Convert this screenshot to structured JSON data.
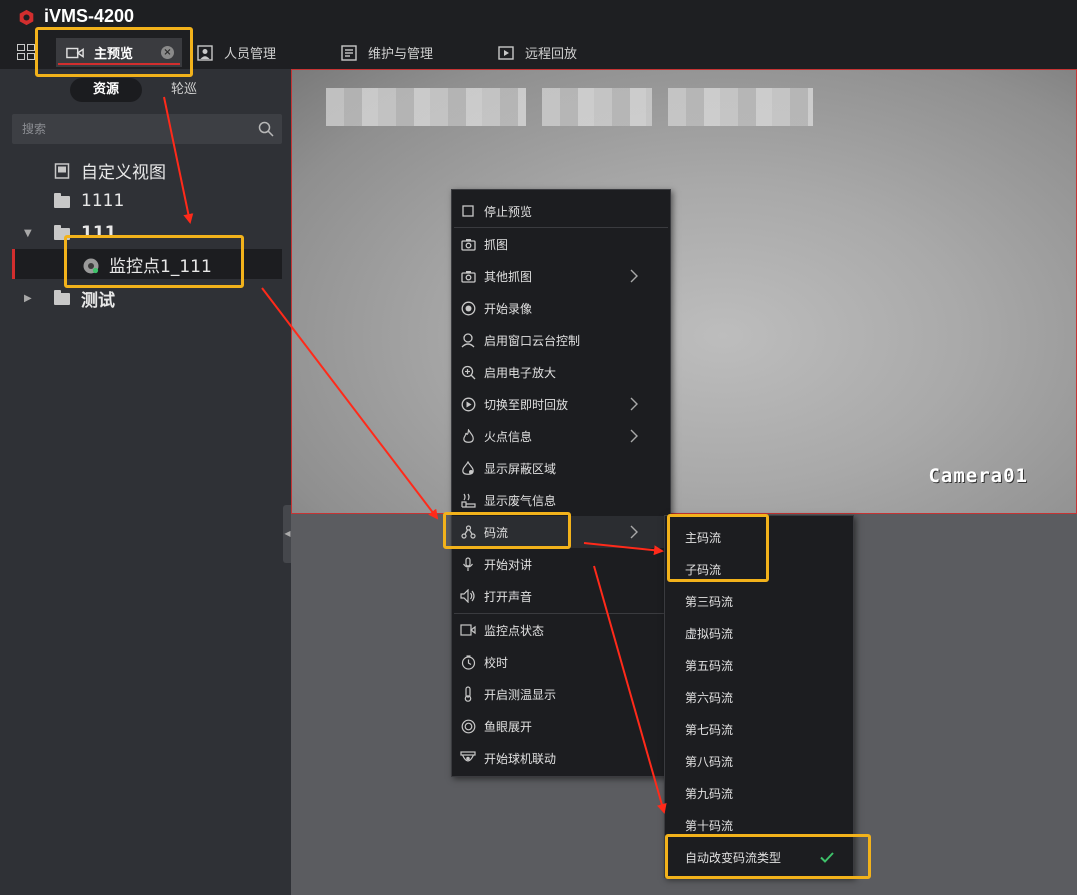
{
  "app": {
    "title": "iVMS-4200"
  },
  "tabs": [
    {
      "label": "主预览",
      "icon": "video-camera-icon",
      "active": true
    },
    {
      "label": "人员管理",
      "icon": "person-card-icon"
    },
    {
      "label": "维护与管理",
      "icon": "maintenance-icon"
    },
    {
      "label": "远程回放",
      "icon": "playback-icon"
    }
  ],
  "sidebar": {
    "segments": [
      {
        "label": "资源",
        "active": true
      },
      {
        "label": "轮巡",
        "active": false
      }
    ],
    "search": {
      "placeholder": "搜索"
    },
    "tree": [
      {
        "label": "自定义视图",
        "icon": "custom-view-icon"
      },
      {
        "label": "1111",
        "icon": "folder-icon"
      },
      {
        "label": "111",
        "icon": "folder-icon",
        "expanded": true
      },
      {
        "label": "监控点1_111",
        "icon": "camera-online-icon",
        "selected": true
      },
      {
        "label": "测试",
        "icon": "folder-icon",
        "expanded": false
      }
    ]
  },
  "video": {
    "osd_label": "Camera01"
  },
  "context_menu": {
    "items": [
      {
        "label": "停止预览",
        "icon": "square-icon"
      },
      {
        "label": "抓图",
        "icon": "camera-icon"
      },
      {
        "label": "其他抓图",
        "icon": "camera-icon",
        "submenu": true
      },
      {
        "label": "开始录像",
        "icon": "record-icon"
      },
      {
        "label": "启用窗口云台控制",
        "icon": "ptz-icon"
      },
      {
        "label": "启用电子放大",
        "icon": "zoom-in-icon"
      },
      {
        "label": "切换至即时回放",
        "icon": "instant-playback-icon",
        "submenu": true
      },
      {
        "label": "火点信息",
        "icon": "fire-icon",
        "submenu": true
      },
      {
        "label": "显示屏蔽区域",
        "icon": "mask-area-icon"
      },
      {
        "label": "显示废气信息",
        "icon": "exhaust-icon"
      },
      {
        "label": "码流",
        "icon": "stream-icon",
        "submenu": true,
        "highlighted": true
      },
      {
        "label": "开始对讲",
        "icon": "microphone-icon"
      },
      {
        "label": "打开声音",
        "icon": "speaker-icon"
      },
      {
        "label": "监控点状态",
        "icon": "camera-status-icon"
      },
      {
        "label": "校时",
        "icon": "clock-icon"
      },
      {
        "label": "开启测温显示",
        "icon": "thermometer-icon"
      },
      {
        "label": "鱼眼展开",
        "icon": "fisheye-icon"
      },
      {
        "label": "开始球机联动",
        "icon": "dome-camera-icon"
      }
    ]
  },
  "stream_submenu": {
    "items": [
      {
        "label": "主码流"
      },
      {
        "label": "子码流"
      },
      {
        "label": "第三码流"
      },
      {
        "label": "虚拟码流"
      },
      {
        "label": "第五码流"
      },
      {
        "label": "第六码流"
      },
      {
        "label": "第七码流"
      },
      {
        "label": "第八码流"
      },
      {
        "label": "第九码流"
      },
      {
        "label": "第十码流"
      },
      {
        "label": "自动改变码流类型",
        "checked": true
      }
    ]
  },
  "colors": {
    "accent_red": "#d22e2e",
    "annotation_yellow": "#f2b21b",
    "check_green": "#3ec26a",
    "arrow_red": "#ff2a1a"
  }
}
